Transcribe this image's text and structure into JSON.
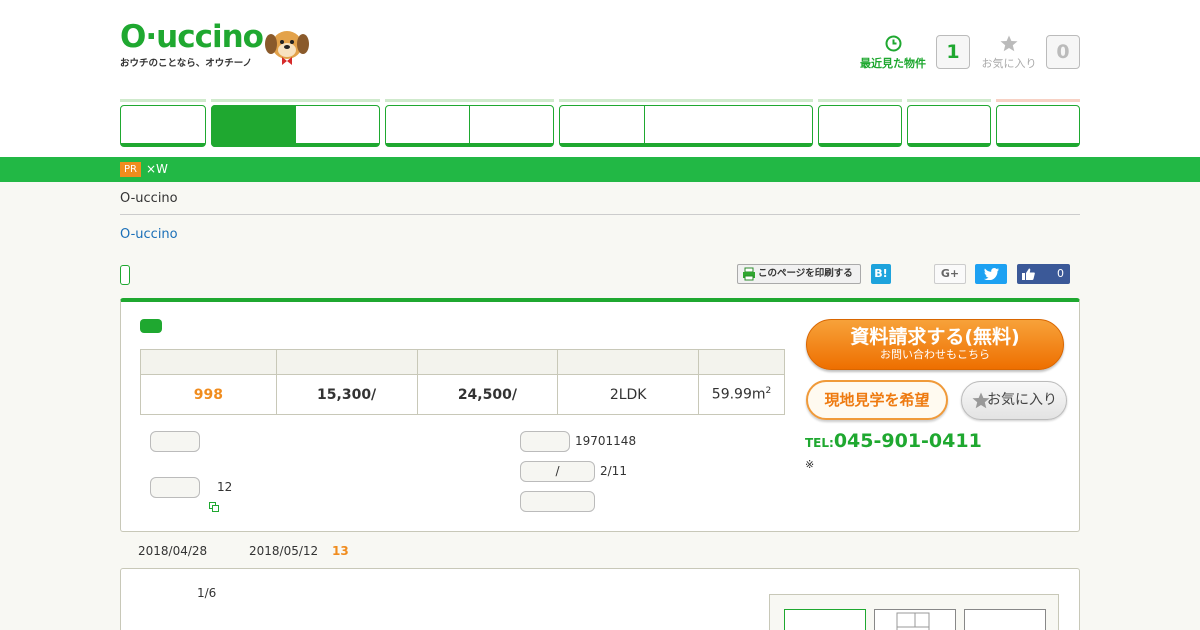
{
  "header": {
    "logo_text": "O·uccino",
    "tagline": "おウチのことなら、オウチーノ",
    "recent_label": "最近見た物件",
    "recent_count": "1",
    "favorites_label": "お気に入り",
    "favorites_count": "0"
  },
  "promo": {
    "pr_badge": "PR",
    "text": "×W"
  },
  "breadcrumb": {
    "site": "O-uccino",
    "link": "O-uccino"
  },
  "share": {
    "print_label": "このページを印刷する",
    "hatena_label": "B!",
    "gplus_label": "G+",
    "facebook_count": "0"
  },
  "summary": {
    "price": "998",
    "management_fee": "15,300/",
    "repair_fund": "24,500/",
    "layout": "2LDK",
    "area": "59.99m",
    "area_sup": "2"
  },
  "details": {
    "built": "19701148",
    "floor": "2/11",
    "floor_tag": "/",
    "units": "12"
  },
  "actions": {
    "request_main": "資料請求する(無料)",
    "request_sub": "お問い合わせもこちら",
    "visit_label": "現地見学を希望",
    "favorite_label": "お気に入り",
    "tel_label": "TEL:",
    "tel_number": "045-901-0411",
    "note": "※"
  },
  "listing": {
    "posted_date": "2018/04/28",
    "update_date": "2018/05/12",
    "days": "13",
    "photo_counter": "1/6"
  },
  "colors": {
    "brand_green": "#1fa830",
    "accent_orange": "#f08c1e"
  }
}
